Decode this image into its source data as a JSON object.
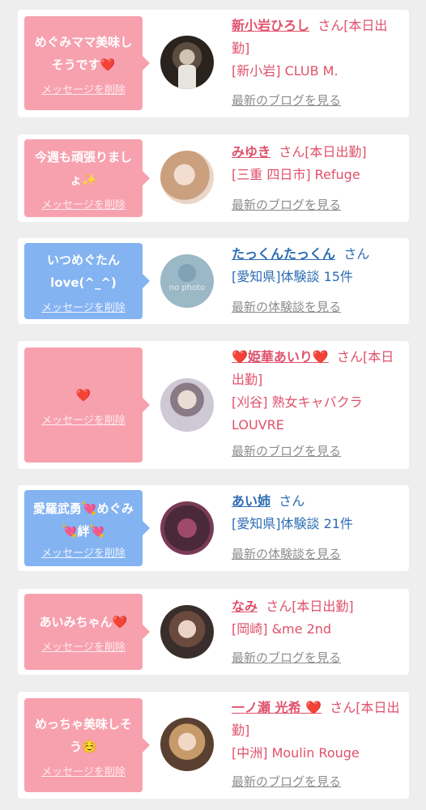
{
  "delete_label": "メッセージを削除",
  "colors": {
    "pink": "#f7a1ae",
    "blue": "#84b3f1",
    "name_pink": "#e0516b",
    "name_blue": "#2c6db3"
  },
  "items": [
    {
      "message": "めぐみママ美味しそうです❤️",
      "name": "新小岩ひろし",
      "suffix": "さん[本日出勤]",
      "detail": "[新小岩] CLUB M.",
      "link": "最新のブログを見る"
    },
    {
      "message": "今週も頑張りましょ✨",
      "name": "みゆき",
      "suffix": "さん[本日出勤]",
      "detail": "[三重 四日市] Refuge",
      "link": "最新のブログを見る"
    },
    {
      "message": "いつめぐたんlove(^_^)",
      "name": "たっくんたっくん",
      "suffix": "さん",
      "detail": "[愛知県]体験談 15件",
      "link": "最新の体験談を見る",
      "avatar_text": "no photo"
    },
    {
      "message": "❤️",
      "name": "❤️姫華あいり❤️",
      "suffix": "さん[本日出勤]",
      "detail": "[刈谷] 熟女キャバクラLOUVRE",
      "link": "最新のブログを見る"
    },
    {
      "message": "愛羅武勇💘めぐみ💘絆💘",
      "name": "あい姉",
      "suffix": "さん",
      "detail": "[愛知県]体験談 21件",
      "link": "最新の体験談を見る"
    },
    {
      "message": "あいみちゃん❤️",
      "name": "なみ",
      "suffix": "さん[本日出勤]",
      "detail": "[岡崎] &me 2nd",
      "link": "最新のブログを見る"
    },
    {
      "message": "めっちゃ美味しそう☺️",
      "name": "一ノ瀬 光希 ❤️",
      "suffix": "さん[本日出勤]",
      "detail": "[中洲] Moulin Rouge",
      "link": "最新のブログを見る"
    }
  ]
}
